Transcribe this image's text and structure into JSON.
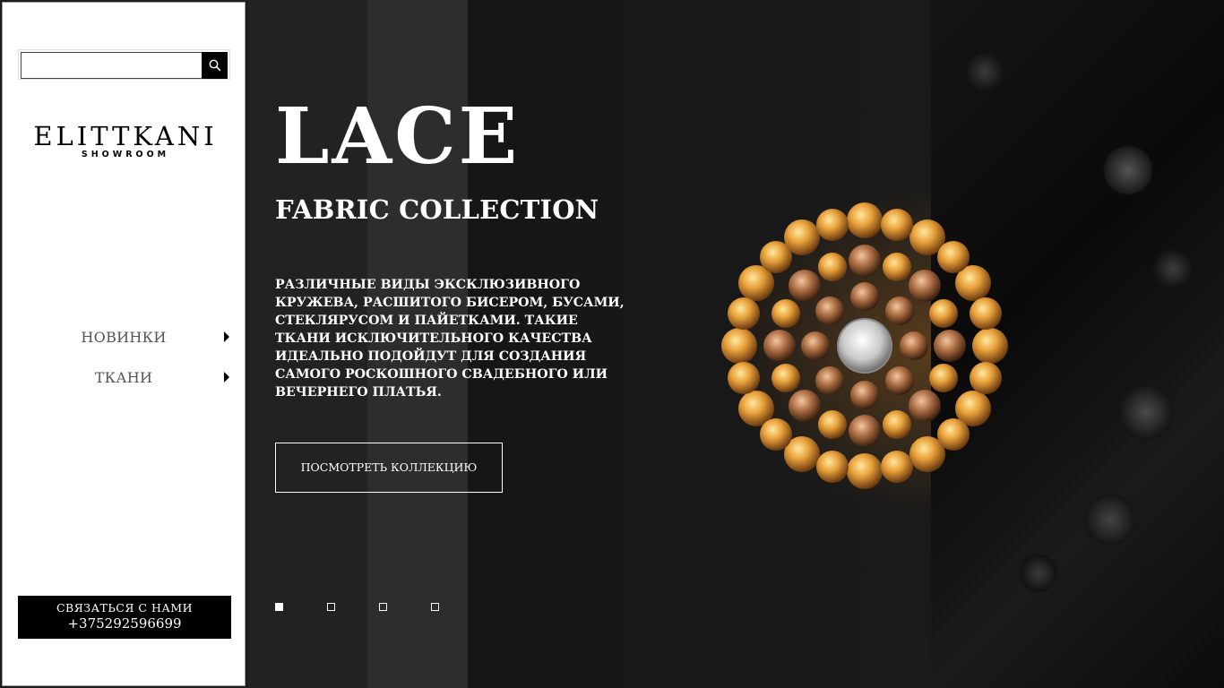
{
  "sidebar": {
    "search": {
      "placeholder": "",
      "value": "",
      "button_icon": "search-icon"
    },
    "logo": {
      "name": "ELITTKANI",
      "sub": "SHOWROOM"
    },
    "nav": [
      {
        "label": "НОВИНКИ",
        "icon": "arrow-right-icon"
      },
      {
        "label": "ТКАНИ",
        "icon": "arrow-right-icon"
      }
    ],
    "contact": {
      "label": "СВЯЗАТЬСЯ С НАМИ",
      "phone": "+375292596699"
    }
  },
  "hero": {
    "title": "LACE",
    "subtitle": "FABRIC COLLECTION",
    "description": "РАЗЛИЧНЫЕ ВИДЫ ЭКСКЛЮЗИВНОГО КРУЖЕВА, РАСШИТОГО БИСЕРОМ, БУСАМИ, СТЕКЛЯРУСОМ И ПАЙЕТКАМИ. ТАКИЕ ТКАНИ ИСКЛЮЧИТЕЛЬНОГО КАЧЕСТВА ИДЕАЛЬНО ПОДОЙДУТ ДЛЯ СОЗДАНИЯ САМОГО РОСКОШНОГО СВАДЕБНОГО ИЛИ ВЕЧЕРНЕГО ПЛАТЬЯ.",
    "cta": "ПОСМОТРЕТЬ КОЛЛЕКЦИЮ",
    "slides": {
      "count": 4,
      "active": 1
    }
  },
  "colors": {
    "accent": "#000000",
    "hero_text": "#ffffff",
    "nav_text": "#555555"
  }
}
